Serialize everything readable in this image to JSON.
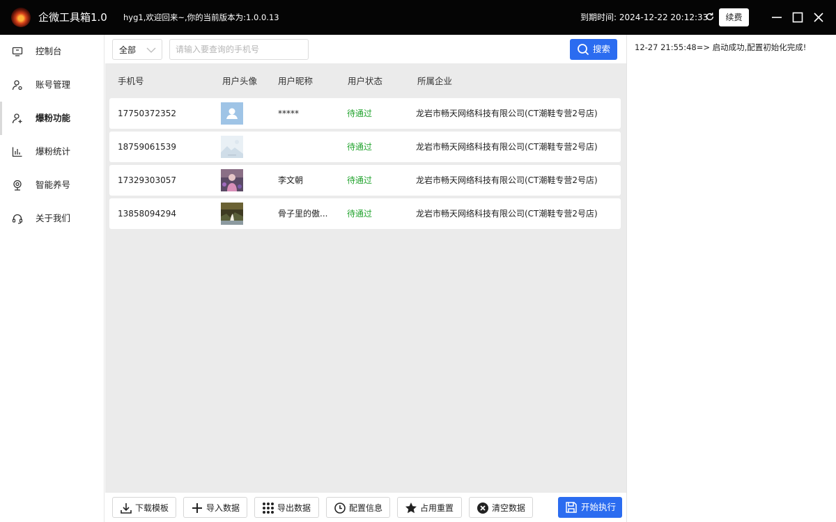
{
  "titlebar": {
    "app_title": "企微工具箱1.0",
    "welcome": "hyg1,欢迎回来~,你的当前版本为:1.0.0.13",
    "expiry": "到期时间: 2024-12-22 20:12:33",
    "renew_label": "续费"
  },
  "sidebar": {
    "items": [
      {
        "label": "控制台",
        "icon": "monitor-icon"
      },
      {
        "label": "账号管理",
        "icon": "user-settings-icon"
      },
      {
        "label": "爆粉功能",
        "icon": "add-user-icon"
      },
      {
        "label": "爆粉统计",
        "icon": "bar-chart-icon"
      },
      {
        "label": "智能养号",
        "icon": "webcam-icon"
      },
      {
        "label": "关于我们",
        "icon": "headset-icon"
      }
    ],
    "active_index": 2
  },
  "toolbar": {
    "filter_value": "全部",
    "search_placeholder": "请输入要查询的手机号",
    "search_label": "搜索"
  },
  "table": {
    "columns": [
      "手机号",
      "用户头像",
      "用户昵称",
      "用户状态",
      "所属企业"
    ],
    "rows": [
      {
        "phone": "17750372352",
        "avatar": "default-avatar",
        "nickname": "*****",
        "status": "待通过",
        "company": "龙岩市畅天网络科技有限公司(CT潮鞋专营2号店)"
      },
      {
        "phone": "18759061539",
        "avatar": "landscape-avatar",
        "nickname": "",
        "status": "待通过",
        "company": "龙岩市畅天网络科技有限公司(CT潮鞋专营2号店)"
      },
      {
        "phone": "17329303057",
        "avatar": "photo-avatar",
        "nickname": "李文朝",
        "status": "待通过",
        "company": "龙岩市畅天网络科技有限公司(CT潮鞋专营2号店)"
      },
      {
        "phone": "13858094294",
        "avatar": "photo-avatar",
        "nickname": "骨子里的傲...",
        "status": "待通过",
        "company": "龙岩市畅天网络科技有限公司(CT潮鞋专营2号店)"
      }
    ]
  },
  "actions": {
    "download_template": "下载模板",
    "import_data": "导入数据",
    "export_data": "导出数据",
    "config_info": "配置信息",
    "reset_usage": "占用重置",
    "clear_data": "清空数据",
    "start_execution": "开始执行"
  },
  "log": {
    "lines": [
      "12-27 21:55:48=> 启动成功,配置初始化完成!"
    ]
  },
  "colors": {
    "titlebar_bg": "#050505",
    "accent": "#2b6cf0",
    "status_green": "#22a32e",
    "table_bg": "#ebebeb"
  }
}
